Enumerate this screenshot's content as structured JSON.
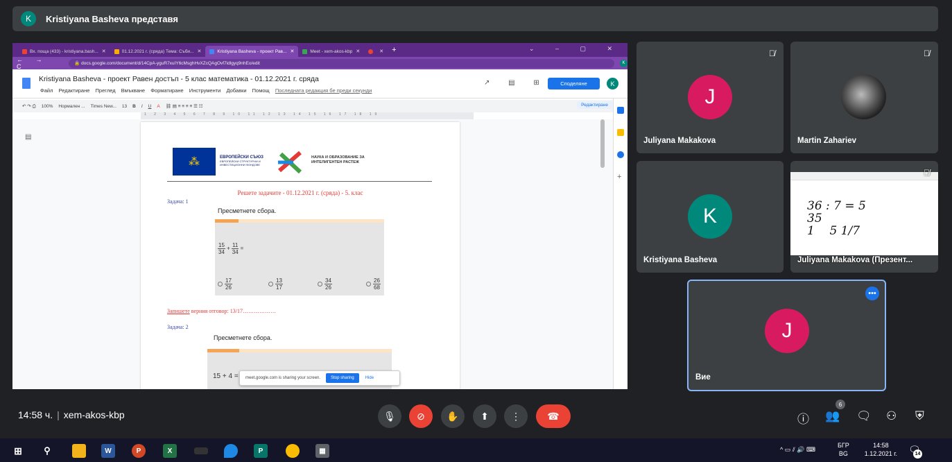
{
  "meet": {
    "presenter_initial": "K",
    "presenter_label": "Kristiyana Basheva представя",
    "time": "14:58 ч.",
    "separator": "|",
    "meeting_code": "xem-akos-kbp",
    "participant_count": "6"
  },
  "browser": {
    "tabs": [
      {
        "label": "Вх. поща (433) - kristiyana.bash...",
        "color": "#ea4335"
      },
      {
        "label": "01.12.2021 г. (сряда) Тема: Съби...",
        "color": "#f9ab00"
      },
      {
        "label": "Kristiyana Basheva - проект Рав...",
        "color": "#4285f4"
      },
      {
        "label": "Meet - xem-akos-kbp",
        "color": "#34a853"
      },
      {
        "label": "",
        "color": "#ea4335"
      }
    ],
    "new_tab": "+",
    "url": "docs.google.com/document/d/14CpA-yguR7xuIY6cMsghHvXZcQAgOvf7idlgyq9nhEo/edit",
    "account_initial": "K"
  },
  "doc": {
    "title": "Kristiyana Basheva - проект Равен достъп - 5 клас математика - 01.12.2021 г. сряда",
    "menus": [
      "Файл",
      "Редактиране",
      "Преглед",
      "Вмъкване",
      "Форматиране",
      "Инструменти",
      "Добавки",
      "Помощ"
    ],
    "last_edit": "Последната редакция бе преди секунди",
    "share": "Споделяне",
    "avatar": "K",
    "toolbar": [
      "100%",
      "Нормален ...",
      "Times New...",
      "13",
      "B",
      "I",
      "U",
      "A"
    ],
    "edit_mode": "Редактиране",
    "ruler": "1 2 3 4 5 6 7 8 9 10 11 12 13 14 15 16 17 18 19",
    "eu_text": "ЕВРОПЕЙСКИ СЪЮЗ",
    "eu_subtext": "ЕВРОПЕЙСКИ СТРУКТУРНИ И ИНВЕСТИЦИОННИ ФОНДОВЕ",
    "program_text": "НАУКА И ОБРАЗОВАНИЕ ЗА ИНТЕЛИГЕНТЕН РАСТЕЖ",
    "heading": "Решете задачите - 01.12.2021 г. (сряда) - 5. клас",
    "task1_label": "Задача: 1",
    "task1_instruction": "Пресметнете сбора.",
    "task1_expr": {
      "a_num": "15",
      "a_den": "34",
      "b_num": "11",
      "b_den": "34",
      "plus": "+",
      "eq": "="
    },
    "task1_options": [
      {
        "num": "17",
        "den": "26"
      },
      {
        "num": "13",
        "den": "17"
      },
      {
        "num": "34",
        "den": "26"
      },
      {
        "num": "26",
        "den": "68"
      }
    ],
    "answer_underlined": "Запишете",
    "answer_rest": " верния отговор: 13/17………………",
    "task2_label": "Задача: 2",
    "task2_instruction": "Пресметнете сбора.",
    "task2_expr": {
      "a_num": "15",
      "plus": "+",
      "b_num": "4",
      "eq": "="
    },
    "sharing_notice": "meet.google.com is sharing your screen.",
    "stop_sharing": "Stop sharing",
    "hide": "Hide"
  },
  "participants": [
    {
      "name": "Juliyana Makakova",
      "initial": "J",
      "color": "#d81b60"
    },
    {
      "name": "Martin Zahariev"
    },
    {
      "name": "Kristiyana Basheva",
      "initial": "K",
      "color": "#00897b"
    },
    {
      "name": "Juliyana Makakova (Презент...",
      "handwriting_1": "36 : 7 = 5",
      "handwriting_2": "35",
      "handwriting_3": "1",
      "handwriting_4": "5 1/7"
    },
    {
      "name": "Вие",
      "initial": "J",
      "color": "#d81b60"
    }
  ],
  "taskbar": {
    "lang": "БГР",
    "lang2": "BG",
    "time": "14:58",
    "date": "1.12.2021 г.",
    "notifications": "14"
  }
}
